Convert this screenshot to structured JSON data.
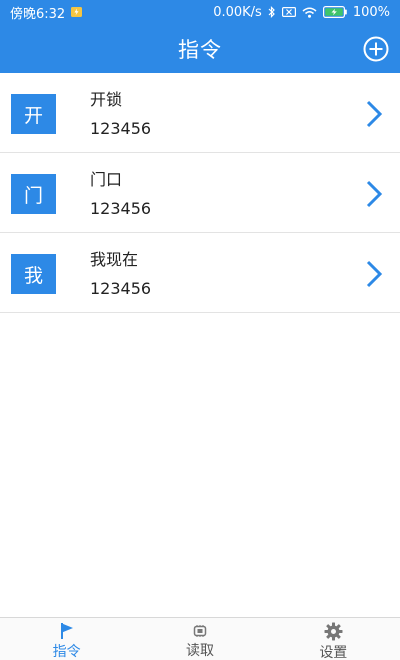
{
  "status_bar": {
    "time": "傍晚6:32",
    "speed": "0.00K/s",
    "battery": "100%"
  },
  "header": {
    "title": "指令"
  },
  "commands": [
    {
      "badge": "开",
      "title": "开锁",
      "code": "123456"
    },
    {
      "badge": "门",
      "title": "门口",
      "code": "123456"
    },
    {
      "badge": "我",
      "title": "我现在",
      "code": "123456"
    }
  ],
  "tabs": [
    {
      "label": "指令",
      "icon": "flag-icon",
      "active": true
    },
    {
      "label": "读取",
      "icon": "chip-icon",
      "active": false
    },
    {
      "label": "设置",
      "icon": "gear-icon",
      "active": false
    }
  ],
  "colors": {
    "primary": "#2d89e6",
    "divider": "#e3e3e3"
  }
}
